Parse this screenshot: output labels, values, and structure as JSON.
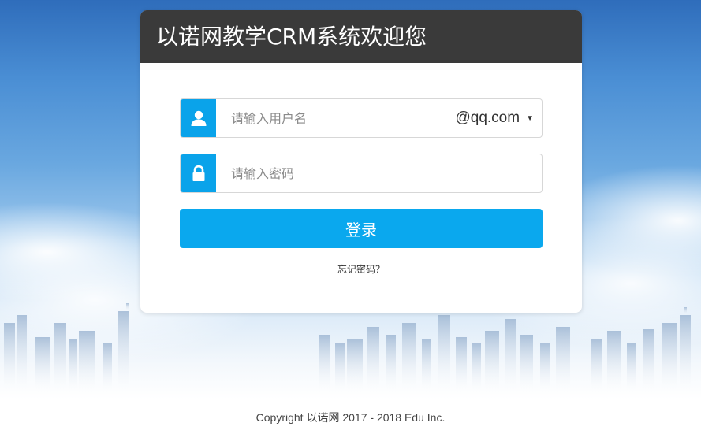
{
  "header": {
    "title": "以诺网教学CRM系统欢迎您"
  },
  "username": {
    "placeholder": "请输入用户名",
    "domain": "@qq.com"
  },
  "password": {
    "placeholder": "请输入密码"
  },
  "login_button": {
    "label": "登录"
  },
  "forgot_link": {
    "label": "忘记密码？"
  },
  "footer": {
    "copyright": "Copyright 以诺网 2017 - 2018 Edu Inc."
  },
  "colors": {
    "accent": "#0aa8ee",
    "header_bg": "#3a3a3a"
  }
}
